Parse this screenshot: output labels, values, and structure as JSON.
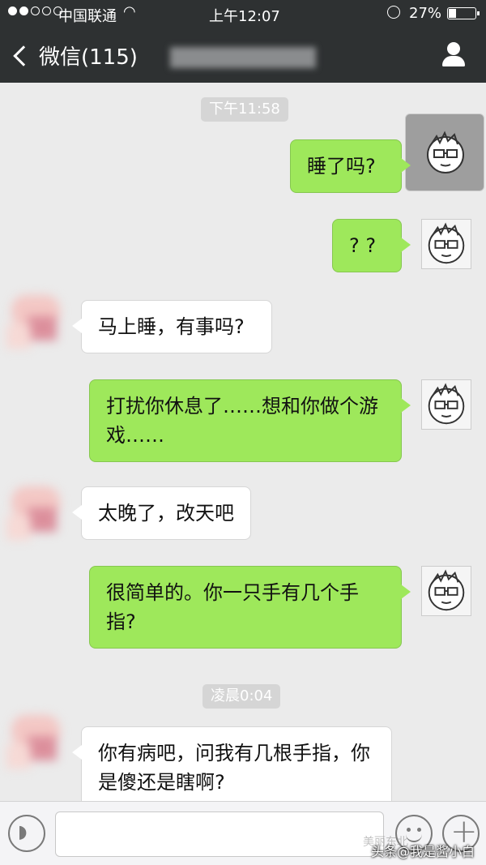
{
  "status_bar": {
    "carrier": "中国联通",
    "time": "上午12:07",
    "battery": "27%",
    "battery_level": 0.27
  },
  "nav": {
    "back_label": "微信(115)"
  },
  "chat": {
    "timestamps": [
      "下午11:58",
      "凌晨0:04"
    ],
    "messages": [
      {
        "from": "me",
        "text": "睡了吗?"
      },
      {
        "from": "me",
        "text": "? ?"
      },
      {
        "from": "them",
        "text": "马上睡，有事吗?"
      },
      {
        "from": "me",
        "text": "打扰你休息了……想和你做个游戏……"
      },
      {
        "from": "them",
        "text": "太晚了，改天吧"
      },
      {
        "from": "me",
        "text": "很简单的。你一只手有几个手指?"
      },
      {
        "from": "them",
        "text": "你有病吧，问我有几根手指，你是傻还是瞎啊?"
      }
    ]
  },
  "input_bar": {
    "voice_icon": "voice-icon",
    "emoji_icon": "emoji-icon",
    "plus_icon": "plus-icon"
  },
  "watermark": {
    "faint": "美丽东北",
    "text": "头条@我是酱小白"
  },
  "colors": {
    "nav_bg": "#2e3132",
    "chat_bg": "#ebebeb",
    "bubble_out": "#9ee85b",
    "bubble_in": "#ffffff"
  }
}
